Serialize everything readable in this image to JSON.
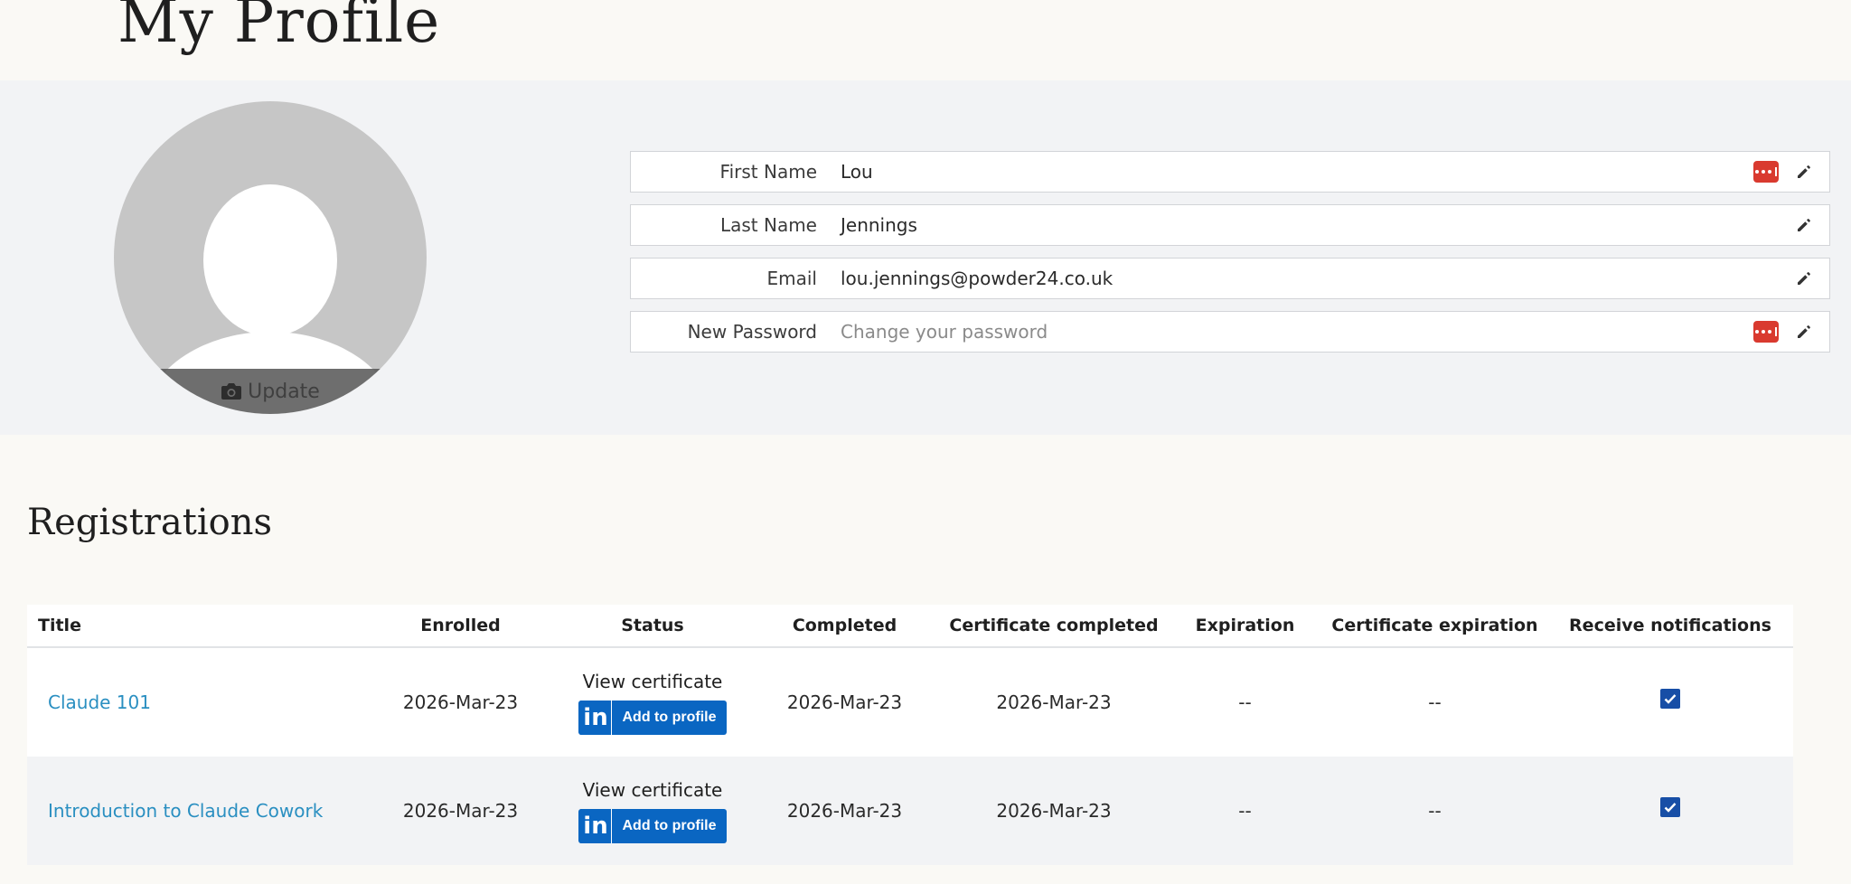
{
  "page": {
    "title": "My Profile"
  },
  "avatar": {
    "update_label": "Update"
  },
  "profile_fields": [
    {
      "label": "First Name",
      "value": "Lou",
      "placeholder": "",
      "has_password_manager_icon": true
    },
    {
      "label": "Last Name",
      "value": "Jennings",
      "placeholder": "",
      "has_password_manager_icon": false
    },
    {
      "label": "Email",
      "value": "lou.jennings@powder24.co.uk",
      "placeholder": "",
      "has_password_manager_icon": false
    },
    {
      "label": "New Password",
      "value": "",
      "placeholder": "Change your password",
      "has_password_manager_icon": true
    }
  ],
  "registrations": {
    "title": "Registrations",
    "columns": [
      "Title",
      "Enrolled",
      "Status",
      "Completed",
      "Certificate completed",
      "Expiration",
      "Certificate expiration",
      "Receive notifications"
    ],
    "rows": [
      {
        "title": "Claude 101",
        "enrolled": "2026-Mar-23",
        "status_link": "View certificate",
        "linkedin_label": "Add to profile",
        "completed": "2026-Mar-23",
        "certificate_completed": "2026-Mar-23",
        "expiration": "--",
        "certificate_expiration": "--",
        "receive_notifications": true
      },
      {
        "title": "Introduction to Claude Cowork",
        "enrolled": "2026-Mar-23",
        "status_link": "View certificate",
        "linkedin_label": "Add to profile",
        "completed": "2026-Mar-23",
        "certificate_completed": "2026-Mar-23",
        "expiration": "--",
        "certificate_expiration": "--",
        "receive_notifications": true
      }
    ]
  },
  "icons": {
    "edit": "pencil-icon",
    "password_manager": "password-manager-icon",
    "camera": "camera-icon",
    "linkedin": "linkedin-icon",
    "checkbox": "checkbox-checked-icon"
  },
  "colors": {
    "link": "#2a8fc1",
    "linkedin": "#0a66c2",
    "password_manager": "#d93a2f",
    "checkbox": "#174ea6"
  }
}
